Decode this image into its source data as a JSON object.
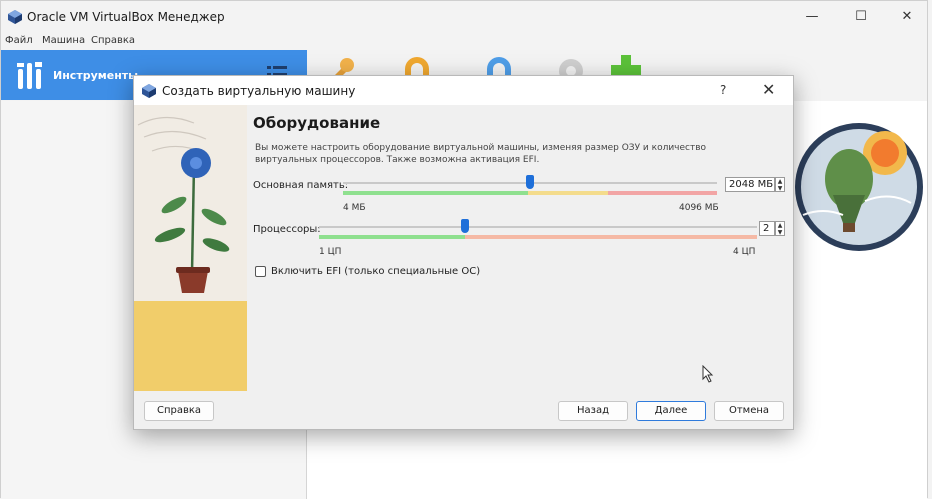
{
  "window": {
    "title": "Oracle VM VirtualBox Менеджер",
    "minimize_glyph": "—",
    "maximize_glyph": "☐",
    "close_glyph": "✕"
  },
  "menu": [
    "Файл",
    "Машина",
    "Справка"
  ],
  "tools": {
    "label": "Инструменты"
  },
  "dialog": {
    "title": "Создать виртуальную машину",
    "help_glyph": "?",
    "close_glyph": "✕",
    "heading": "Оборудование",
    "description": "Вы можете настроить оборудование виртуальной машины, изменяя размер ОЗУ и количество виртуальных процессоров. Также возможна активация EFI.",
    "memory": {
      "label": "Основная память:",
      "value": "2048 МБ",
      "min_label": "4 МБ",
      "max_label": "4096 МБ",
      "level": 0.5
    },
    "cpu": {
      "label": "Процессоры:",
      "value": "2",
      "min_label": "1 ЦП",
      "max_label": "4 ЦП",
      "level": 0.333
    },
    "efi": {
      "label": "Включить EFI (только специальные ОС)",
      "checked": false
    },
    "buttons": {
      "help": "Справка",
      "back": "Назад",
      "next": "Далее",
      "cancel": "Отмена"
    }
  },
  "colors": {
    "accent": "#3e8ee6",
    "thumb": "#1e6fd9",
    "green": "#5cc95c",
    "red": "#ef8a8a"
  }
}
